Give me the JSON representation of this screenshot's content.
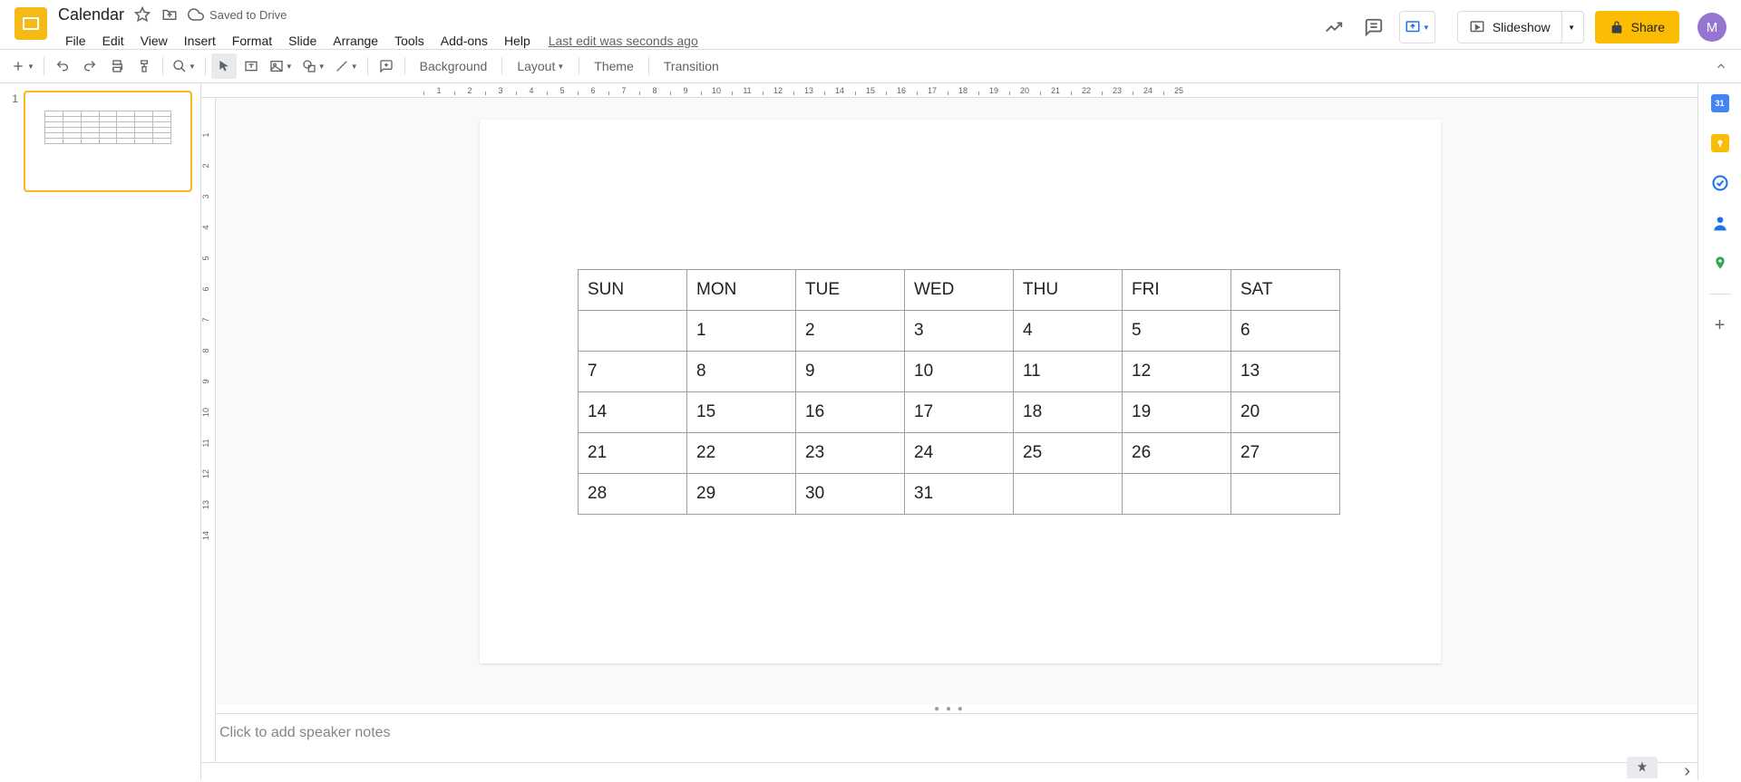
{
  "doc": {
    "title": "Calendar",
    "saved_status": "Saved to Drive",
    "last_edit": "Last edit was seconds ago"
  },
  "menu": {
    "file": "File",
    "edit": "Edit",
    "view": "View",
    "insert": "Insert",
    "format": "Format",
    "slide": "Slide",
    "arrange": "Arrange",
    "tools": "Tools",
    "addons": "Add-ons",
    "help": "Help"
  },
  "header_buttons": {
    "slideshow": "Slideshow",
    "share": "Share",
    "avatar_letter": "M"
  },
  "toolbar": {
    "background": "Background",
    "layout": "Layout",
    "theme": "Theme",
    "transition": "Transition"
  },
  "slides": {
    "thumb1_num": "1"
  },
  "ruler_h": [
    "1",
    "2",
    "3",
    "4",
    "5",
    "6",
    "7",
    "8",
    "9",
    "10",
    "11",
    "12",
    "13",
    "14",
    "15",
    "16",
    "17",
    "18",
    "19",
    "20",
    "21",
    "22",
    "23",
    "24",
    "25"
  ],
  "ruler_v": [
    "1",
    "2",
    "3",
    "4",
    "5",
    "6",
    "7",
    "8",
    "9",
    "10",
    "11",
    "12",
    "13",
    "14"
  ],
  "calendar": {
    "headers": [
      "SUN",
      "MON",
      "TUE",
      "WED",
      "THU",
      "FRI",
      "SAT"
    ],
    "rows": [
      [
        "",
        "1",
        "2",
        "3",
        "4",
        "5",
        "6"
      ],
      [
        "7",
        "8",
        "9",
        "10",
        "11",
        "12",
        "13"
      ],
      [
        "14",
        "15",
        "16",
        "17",
        "18",
        "19",
        "20"
      ],
      [
        "21",
        "22",
        "23",
        "24",
        "25",
        "26",
        "27"
      ],
      [
        "28",
        "29",
        "30",
        "31",
        "",
        "",
        ""
      ]
    ]
  },
  "notes": {
    "placeholder": "Click to add speaker notes"
  }
}
